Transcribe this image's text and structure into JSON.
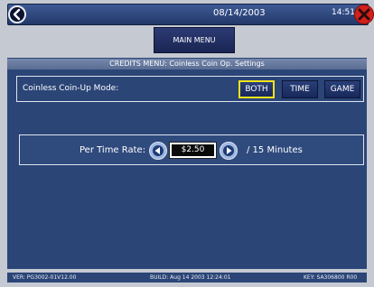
{
  "header": {
    "date": "08/14/2003",
    "time": "14:51",
    "back_icon": "back-arrow-icon",
    "close_icon": "close-x-icon"
  },
  "nav": {
    "main_menu_label": "MAIN MENU"
  },
  "panel": {
    "title": "CREDITS MENU: Coinless Coin Op. Settings",
    "mode": {
      "label": "Coinless Coin-Up Mode:",
      "options": [
        "BOTH",
        "TIME",
        "GAME"
      ],
      "selected": "BOTH"
    },
    "rate": {
      "label": "Per Time Rate:",
      "value": "$2.50",
      "unit": "/ 15 Minutes"
    }
  },
  "footer": {
    "version": "VER: PG3002-01V12.00",
    "build": "BUILD: Aug 14 2003 12:24:01",
    "key": "KEY: SA306800 R00"
  },
  "colors": {
    "selection": "#f4e41c",
    "close": "#d51f1a",
    "panel": "#2b4577"
  }
}
